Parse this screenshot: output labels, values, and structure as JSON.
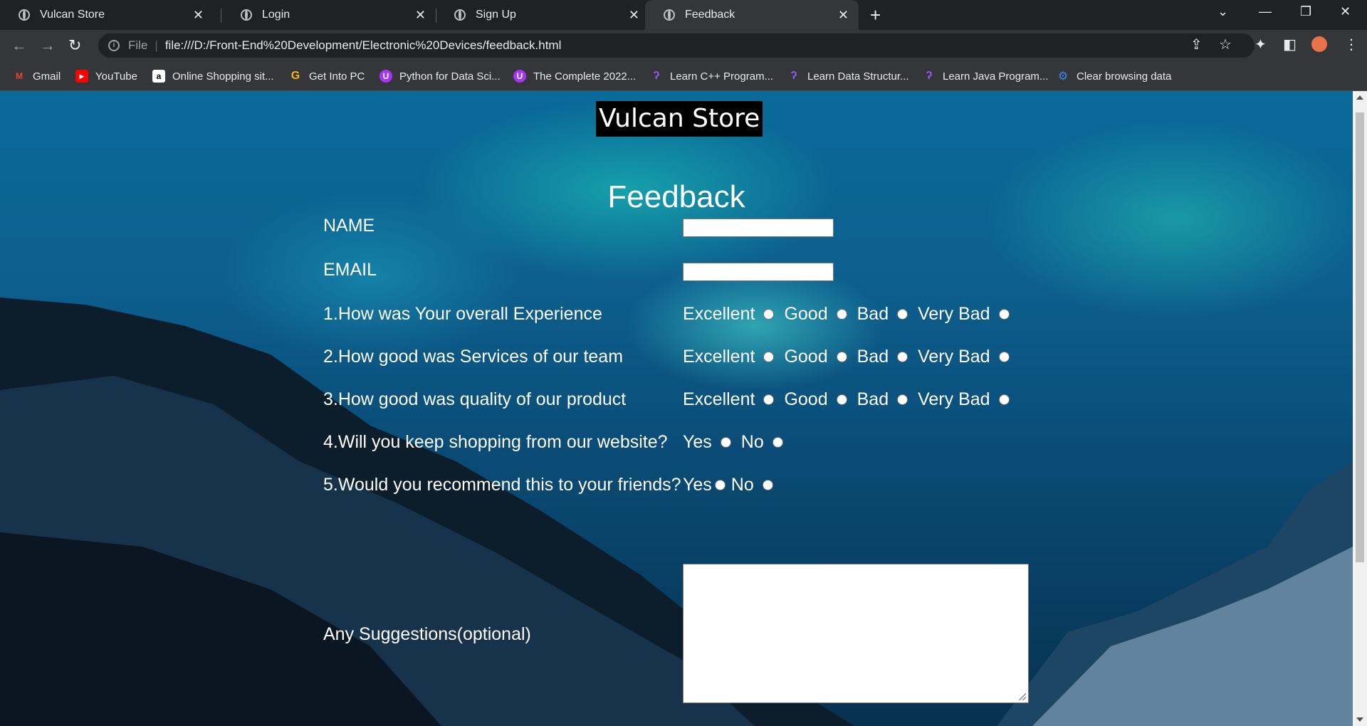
{
  "browser": {
    "tabs": [
      {
        "title": "Vulcan Store",
        "active": false
      },
      {
        "title": "Login",
        "active": false
      },
      {
        "title": "Sign Up",
        "active": false
      },
      {
        "title": "Feedback",
        "active": true
      }
    ],
    "url_scheme": "File",
    "url": "file:///D:/Front-End%20Development/Electronic%20Devices/feedback.html",
    "bookmarks": [
      {
        "label": "Gmail",
        "icon": "gmail-icon"
      },
      {
        "label": "YouTube",
        "icon": "youtube-icon"
      },
      {
        "label": "Online Shopping sit...",
        "icon": "amazon-icon"
      },
      {
        "label": "Get Into PC",
        "icon": "getintopc-icon"
      },
      {
        "label": "Python for Data Sci...",
        "icon": "udemy-icon"
      },
      {
        "label": "The Complete 2022...",
        "icon": "udemy-icon"
      },
      {
        "label": "Learn C++ Program...",
        "icon": "codingninjas-icon"
      },
      {
        "label": "Learn Data Structur...",
        "icon": "codingninjas-icon"
      },
      {
        "label": "Learn Java Program...",
        "icon": "codingninjas-icon"
      },
      {
        "label": "Clear browsing data",
        "icon": "settings-gear-icon"
      }
    ]
  },
  "page": {
    "store_title": "Vulcan Store",
    "heading": "Feedback",
    "fields": {
      "name_label": "NAME",
      "email_label": "EMAIL",
      "suggestions_label": "Any Suggestions(optional)"
    },
    "questions": [
      {
        "label": "1.How was Your overall Experience",
        "options": [
          "Excellent",
          "Good",
          "Bad",
          "Very Bad"
        ]
      },
      {
        "label": "2.How good was Services of our team",
        "options": [
          "Excellent",
          "Good",
          "Bad",
          "Very Bad"
        ]
      },
      {
        "label": "3.How good was quality of our product",
        "options": [
          "Excellent",
          "Good",
          "Bad",
          "Very Bad"
        ]
      },
      {
        "label": "4.Will you keep shopping from our website?",
        "options": [
          "Yes",
          "No"
        ]
      },
      {
        "label": "5.Would you recommend this to your friends?",
        "options": [
          "Yes",
          "No"
        ]
      }
    ]
  }
}
